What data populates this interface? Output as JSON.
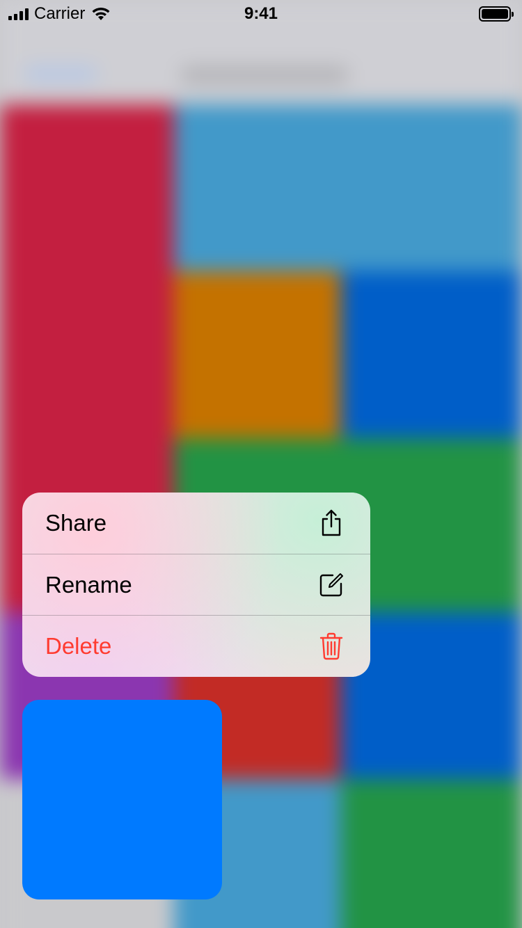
{
  "status_bar": {
    "carrier": "Carrier",
    "time": "9:41"
  },
  "context_menu": {
    "items": [
      {
        "label": "Share",
        "icon": "share-icon",
        "destructive": false
      },
      {
        "label": "Rename",
        "icon": "compose-icon",
        "destructive": false
      },
      {
        "label": "Delete",
        "icon": "trash-icon",
        "destructive": true
      }
    ]
  },
  "colors": {
    "accent_blue": "#007aff",
    "destructive_red": "#ff3b30",
    "bg_red": "#c31f40",
    "bg_light_blue": "#4299c9",
    "bg_orange": "#c47200",
    "bg_blue": "#005ec8",
    "bg_green": "#229344",
    "bg_purple": "#8b36b0",
    "bg_dark_red": "#c22b25"
  },
  "preview": {
    "color": "#007aff"
  }
}
